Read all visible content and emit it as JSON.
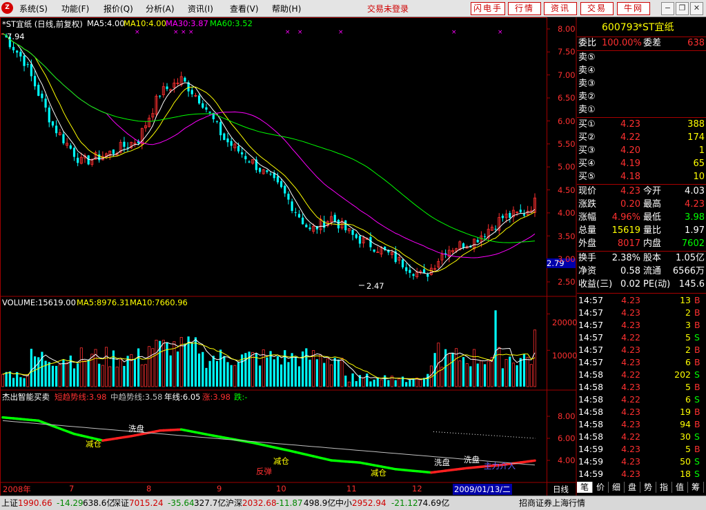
{
  "menu": {
    "items": [
      "系统(S)",
      "功能(F)",
      "报价(Q)",
      "分析(A)",
      "资讯(I)",
      "查看(V)",
      "帮助(H)"
    ],
    "status": "交易未登录",
    "buttons": [
      "闪电手",
      "行情",
      "资讯",
      "交易",
      "牛网"
    ]
  },
  "chart": {
    "title": "*ST宜纸 (日线,前复权)",
    "ma": [
      {
        "label": "MA5:4.00",
        "color": "#ffffff"
      },
      {
        "label": "MA10:4.00",
        "color": "#ffff00"
      },
      {
        "label": "MA30:3.87",
        "color": "#ff00ff"
      },
      {
        "label": "MA60:3.52",
        "color": "#00ff00"
      }
    ],
    "high_label": "7.94",
    "low_label": "2.47",
    "current_price_tag": "2.79",
    "y_axis": [
      "8.00",
      "7.50",
      "7.00",
      "6.50",
      "6.00",
      "5.50",
      "5.00",
      "4.50",
      "4.00",
      "3.50",
      "3.00",
      "2.50"
    ],
    "volume": {
      "title": "VOLUME:15619.00",
      "ma5": "MA5:8976.31",
      "ma10": "MA10:7660.96",
      "y_axis": [
        "20000",
        "10000"
      ]
    },
    "indicator": {
      "title": "杰出智能买卖",
      "short": "短趋势线:3.98",
      "mid": "中趋势线:3.58",
      "year": "年线:6.05",
      "up": "涨:3.98",
      "down": "跌:-",
      "y_axis": [
        "8.00",
        "6.00",
        "4.00"
      ],
      "signals": [
        "洗盘",
        "减仓",
        "反弹",
        "减仓",
        "减仓",
        "洗盘",
        "洗盘",
        "主力介入"
      ]
    },
    "x_axis": [
      "2008年",
      "7",
      "8",
      "9",
      "10",
      "11",
      "12",
      "2009/01/13/二"
    ],
    "period": "日线"
  },
  "chart_data": {
    "type": "candlestick",
    "title": "*ST宜纸 (日线,前复权)",
    "x_range": [
      "2008-06",
      "2009-01-13"
    ],
    "price_range": [
      2.3,
      8.1
    ],
    "max_price": 7.94,
    "min_price": 2.47,
    "close_points": [
      {
        "x": "2008-06",
        "close": 7.9
      },
      {
        "x": "2008-07",
        "close": 5.2
      },
      {
        "x": "2008-08",
        "close": 6.8
      },
      {
        "x": "2008-09",
        "close": 4.9
      },
      {
        "x": "2008-10",
        "close": 3.8
      },
      {
        "x": "2008-11",
        "close": 2.6
      },
      {
        "x": "2008-12",
        "close": 3.4
      },
      {
        "x": "2009-01-13",
        "close": 4.23
      }
    ],
    "volume_max": 22000
  },
  "stock": {
    "code": "600793",
    "name": "*ST宜纸",
    "weibi_label": "委比",
    "weibi": "100.00%",
    "weicha_label": "委差",
    "weicha": "638",
    "asks": [
      {
        "label": "卖⑤",
        "price": "",
        "vol": ""
      },
      {
        "label": "卖④",
        "price": "",
        "vol": ""
      },
      {
        "label": "卖③",
        "price": "",
        "vol": ""
      },
      {
        "label": "卖②",
        "price": "",
        "vol": ""
      },
      {
        "label": "卖①",
        "price": "",
        "vol": ""
      }
    ],
    "bids": [
      {
        "label": "买①",
        "price": "4.23",
        "vol": "388"
      },
      {
        "label": "买②",
        "price": "4.22",
        "vol": "174"
      },
      {
        "label": "买③",
        "price": "4.20",
        "vol": "1"
      },
      {
        "label": "买④",
        "price": "4.19",
        "vol": "65"
      },
      {
        "label": "买⑤",
        "price": "4.18",
        "vol": "10"
      }
    ],
    "quote": [
      {
        "l1": "现价",
        "v1": "4.23",
        "c1": "#ff3030",
        "l2": "今开",
        "v2": "4.03",
        "c2": "#ffffff"
      },
      {
        "l1": "涨跌",
        "v1": "0.20",
        "c1": "#ff3030",
        "l2": "最高",
        "v2": "4.23",
        "c2": "#ff3030"
      },
      {
        "l1": "涨幅",
        "v1": "4.96%",
        "c1": "#ff3030",
        "l2": "最低",
        "v2": "3.98",
        "c2": "#00ff00"
      },
      {
        "l1": "总量",
        "v1": "15619",
        "c1": "#ffff00",
        "l2": "量比",
        "v2": "1.97",
        "c2": "#ffffff"
      },
      {
        "l1": "外盘",
        "v1": "8017",
        "c1": "#ff3030",
        "l2": "内盘",
        "v2": "7602",
        "c2": "#00ff00"
      }
    ],
    "info": [
      {
        "l1": "换手",
        "v1": "2.38%",
        "l2": "股本",
        "v2": "1.05亿"
      },
      {
        "l1": "净资",
        "v1": "0.58",
        "l2": "流通",
        "v2": "6566万"
      },
      {
        "l1": "收益(三)",
        "v1": "0.02",
        "l2": "PE(动)",
        "v2": "145.6"
      }
    ],
    "ticks": [
      {
        "time": "14:57",
        "price": "4.23",
        "vol": "13",
        "bs": "B"
      },
      {
        "time": "14:57",
        "price": "4.23",
        "vol": "2",
        "bs": "B"
      },
      {
        "time": "14:57",
        "price": "4.23",
        "vol": "3",
        "bs": "B"
      },
      {
        "time": "14:57",
        "price": "4.22",
        "vol": "5",
        "bs": "S"
      },
      {
        "time": "14:57",
        "price": "4.23",
        "vol": "2",
        "bs": "B"
      },
      {
        "time": "14:57",
        "price": "4.23",
        "vol": "6",
        "bs": "B"
      },
      {
        "time": "14:58",
        "price": "4.22",
        "vol": "202",
        "bs": "S"
      },
      {
        "time": "14:58",
        "price": "4.23",
        "vol": "5",
        "bs": "B"
      },
      {
        "time": "14:58",
        "price": "4.22",
        "vol": "6",
        "bs": "S"
      },
      {
        "time": "14:58",
        "price": "4.23",
        "vol": "19",
        "bs": "B"
      },
      {
        "time": "14:58",
        "price": "4.23",
        "vol": "94",
        "bs": "B"
      },
      {
        "time": "14:58",
        "price": "4.22",
        "vol": "30",
        "bs": "S"
      },
      {
        "time": "14:59",
        "price": "4.23",
        "vol": "5",
        "bs": "B"
      },
      {
        "time": "14:59",
        "price": "4.23",
        "vol": "50",
        "bs": "S"
      },
      {
        "time": "14:59",
        "price": "4.23",
        "vol": "18",
        "bs": "S"
      }
    ],
    "tabs": [
      "笔",
      "价",
      "细",
      "盘",
      "势",
      "指",
      "值",
      "筹"
    ]
  },
  "statusbar": {
    "sh_label": "上证",
    "sh_val": "1990.66",
    "sh_chg": "-14.29",
    "sh_amt": "638.6亿",
    "sz_label": "深证",
    "sz_val": "7015.24",
    "sz_chg": "-35.64",
    "sz_amt": "327.7亿",
    "hs_label": "沪深",
    "hs_val": "2032.68",
    "hs_chg": "-11.87",
    "hs_amt": "498.9亿",
    "zx_label": "中小",
    "zx_val": "2952.94",
    "zx_chg": "-21.12",
    "zx_amt": "74.69亿",
    "broker": "招商证券上海行情"
  }
}
